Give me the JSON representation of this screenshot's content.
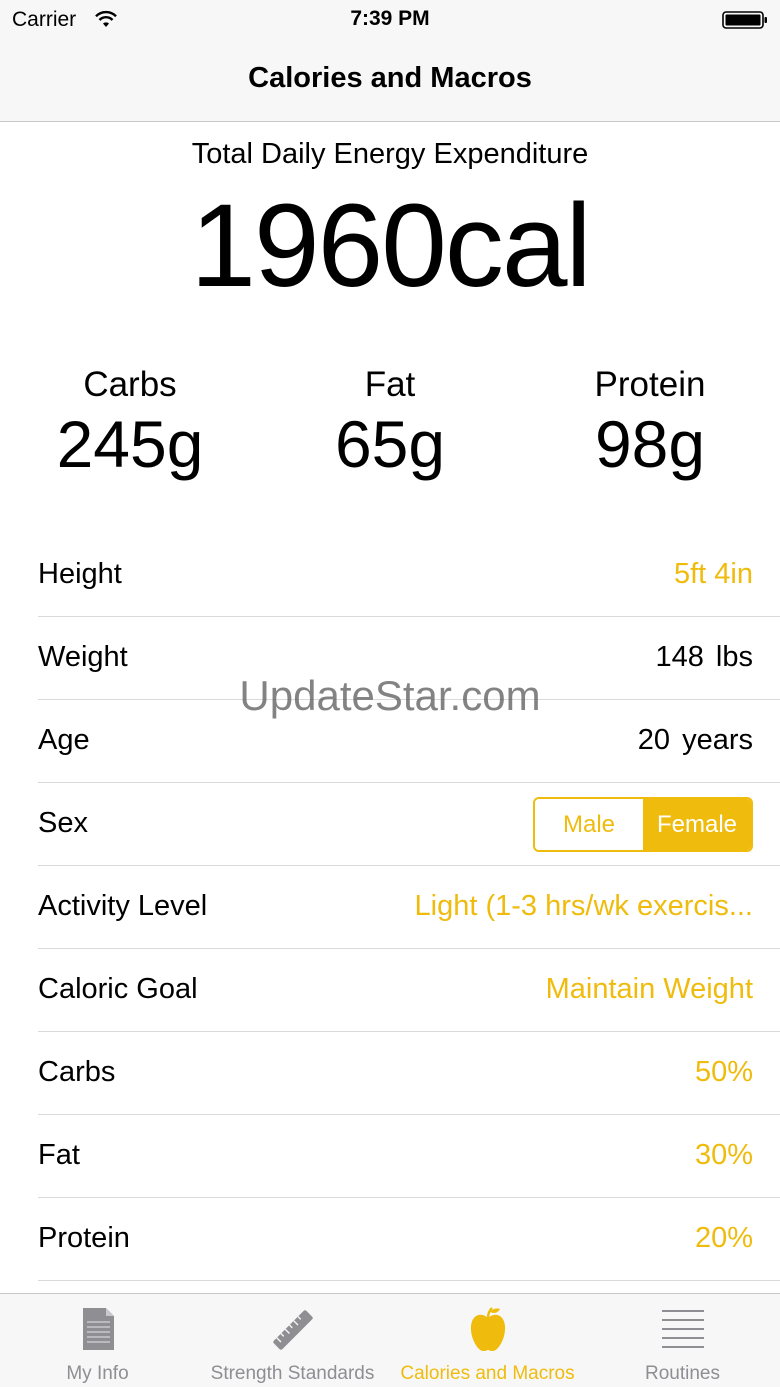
{
  "status_bar": {
    "carrier": "Carrier",
    "time": "7:39 PM"
  },
  "nav": {
    "title": "Calories and Macros"
  },
  "tdee": {
    "label": "Total Daily Energy Expenditure",
    "value": "1960cal"
  },
  "macros": [
    {
      "label": "Carbs",
      "value": "245g"
    },
    {
      "label": "Fat",
      "value": "65g"
    },
    {
      "label": "Protein",
      "value": "98g"
    }
  ],
  "settings": {
    "height": {
      "label": "Height",
      "value": "5ft 4in"
    },
    "weight": {
      "label": "Weight",
      "value": "148 lbs"
    },
    "age": {
      "label": "Age",
      "value": "20 years"
    },
    "sex": {
      "label": "Sex",
      "options": [
        "Male",
        "Female"
      ],
      "selected": "Female"
    },
    "activity": {
      "label": "Activity Level",
      "value": "Light (1-3 hrs/wk exercis..."
    },
    "goal": {
      "label": "Caloric Goal",
      "value": "Maintain Weight"
    },
    "carbs": {
      "label": "Carbs",
      "value": "50%"
    },
    "fat": {
      "label": "Fat",
      "value": "30%"
    },
    "protein": {
      "label": "Protein",
      "value": "20%"
    }
  },
  "watermark": "UpdateStar.com",
  "tabs": [
    {
      "label": "My Info",
      "icon": "document-icon",
      "active": false
    },
    {
      "label": "Strength Standards",
      "icon": "ruler-icon",
      "active": false
    },
    {
      "label": "Calories and Macros",
      "icon": "apple-icon",
      "active": true
    },
    {
      "label": "Routines",
      "icon": "list-icon",
      "active": false
    }
  ],
  "colors": {
    "accent": "#efbc0e",
    "inactive_tab": "#8e8e93",
    "bar_background": "#f7f7f7"
  }
}
